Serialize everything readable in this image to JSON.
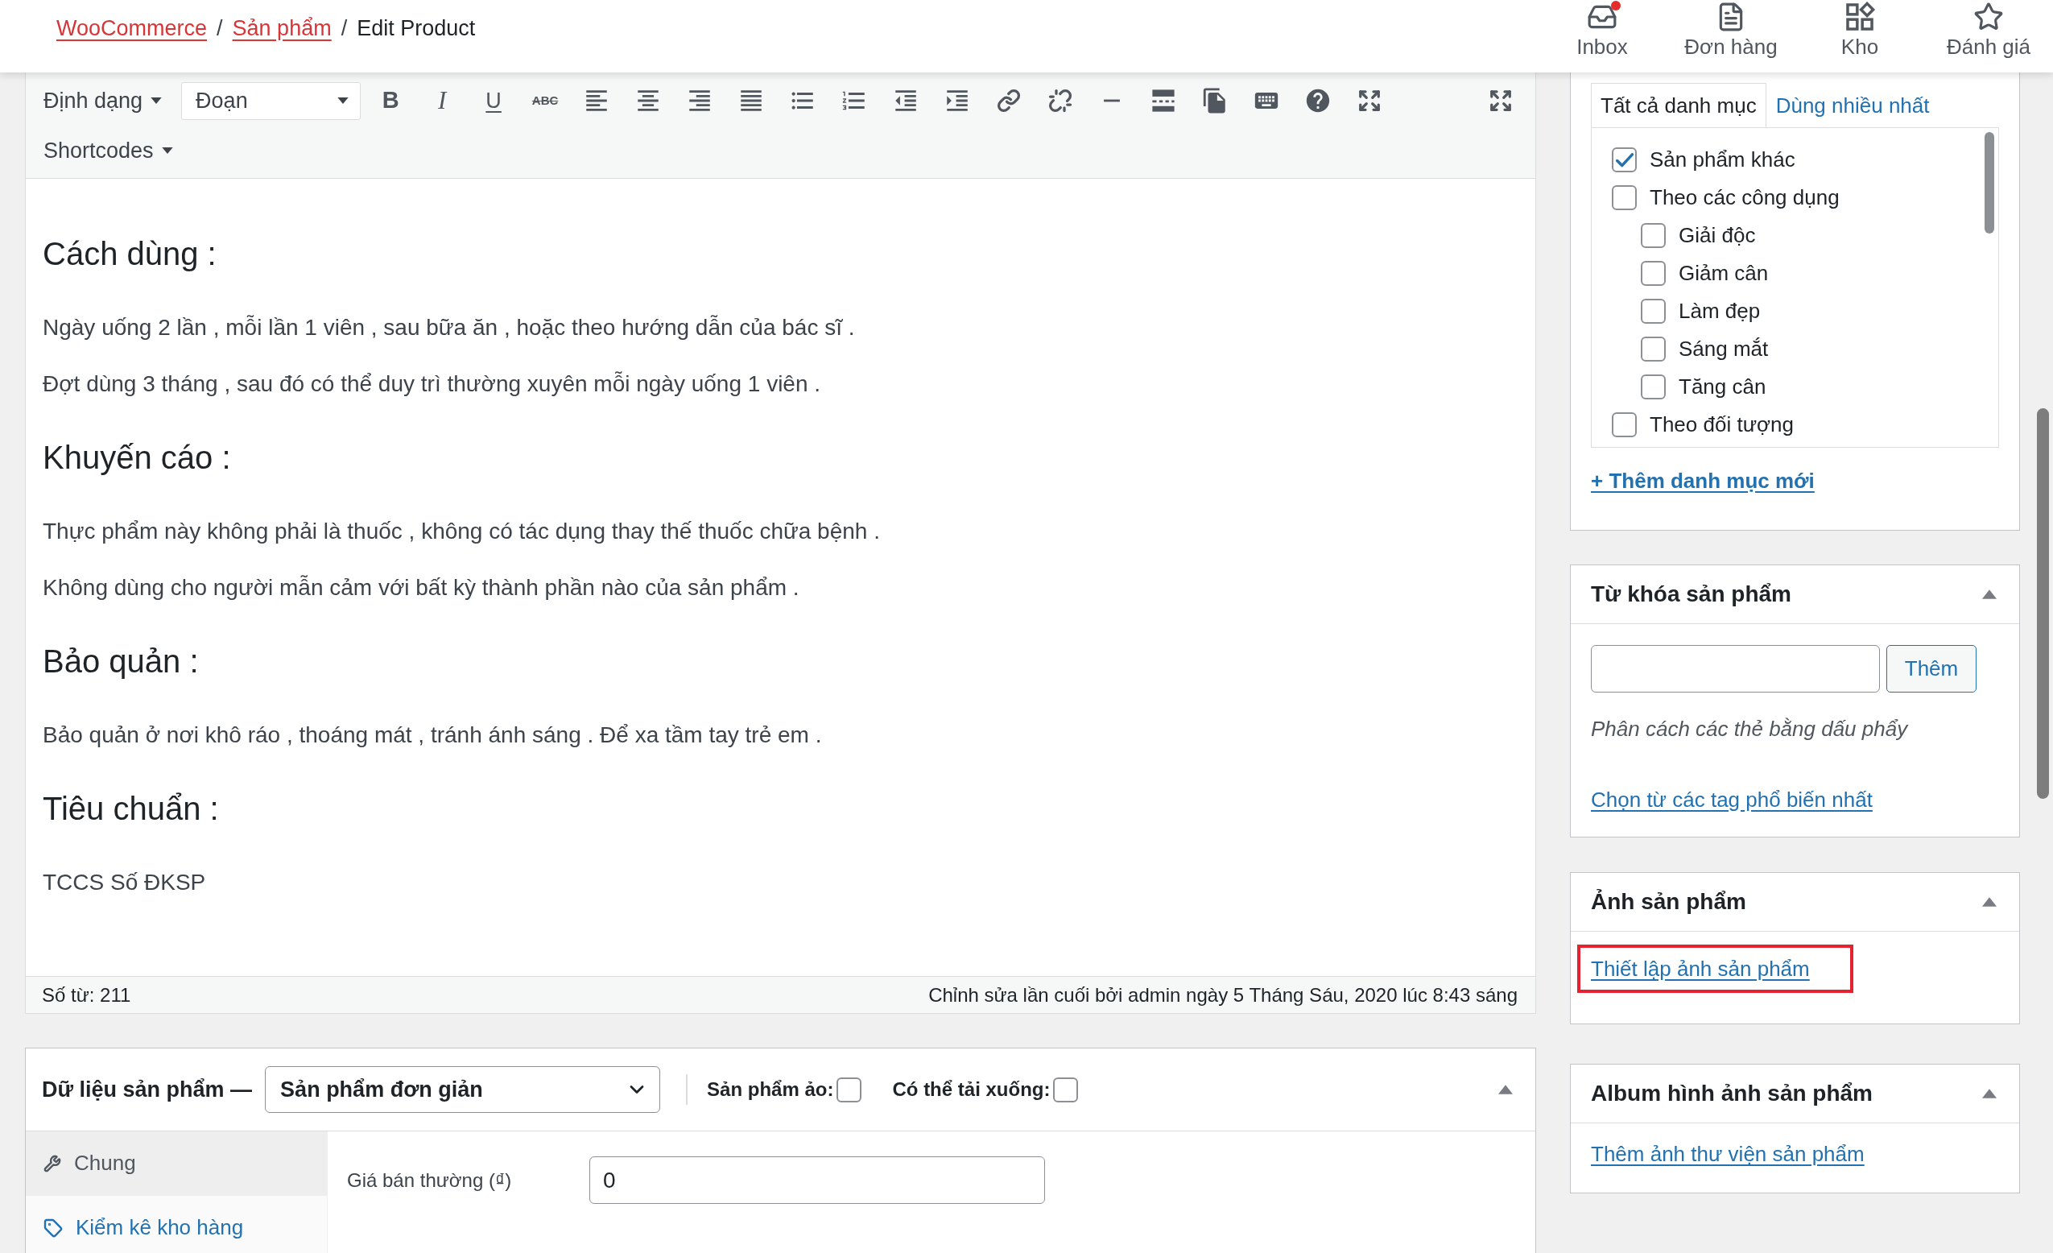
{
  "header": {
    "breadcrumb": [
      {
        "kind": "link",
        "label": "WooCommerce"
      },
      {
        "kind": "separator",
        "label": "/"
      },
      {
        "kind": "link",
        "label": "Sản phẩm"
      },
      {
        "kind": "separator",
        "label": "/"
      },
      {
        "kind": "current",
        "label": "Edit Product"
      }
    ],
    "nav": [
      {
        "label": "Inbox",
        "unread": true
      },
      {
        "label": "Đơn hàng",
        "unread": false
      },
      {
        "label": "Kho",
        "unread": false
      },
      {
        "label": "Đánh giá",
        "unread": false
      }
    ]
  },
  "editor": {
    "toolbar": {
      "format_menu": "Định dạng",
      "block_format": "Đoạn",
      "text_buttons": [
        {
          "kind": "bold",
          "label": "B"
        },
        {
          "kind": "italic",
          "label": "I"
        },
        {
          "kind": "underline",
          "label": "U"
        },
        {
          "kind": "strike",
          "label": "ABC"
        }
      ],
      "shortcodes_menu": "Shortcodes"
    },
    "content": [
      {
        "kind": "heading",
        "text": "Cách dùng :"
      },
      {
        "kind": "paragraph",
        "text": "Ngày uống 2 lần , mỗi lần 1 viên , sau bữa ăn , hoặc theo hướng dẫn của bác sĩ ."
      },
      {
        "kind": "paragraph",
        "text": "Đợt dùng 3 tháng , sau đó có thể duy trì thường xuyên mỗi ngày uống 1 viên ."
      },
      {
        "kind": "heading",
        "text": "Khuyến cáo :"
      },
      {
        "kind": "paragraph",
        "text": "Thực phẩm này không phải là thuốc , không có tác dụng thay thế thuốc chữa bệnh ."
      },
      {
        "kind": "paragraph",
        "text": "Không dùng cho người mẫn cảm với bất kỳ thành phần nào của sản phẩm ."
      },
      {
        "kind": "heading",
        "text": "Bảo quản :"
      },
      {
        "kind": "paragraph",
        "text": "Bảo quản ở nơi khô ráo , thoáng mát , tránh ánh sáng . Để xa tầm tay trẻ em ."
      },
      {
        "kind": "heading",
        "text": "Tiêu chuẩn :"
      },
      {
        "kind": "paragraph",
        "text": "TCCS Số ĐKSP"
      }
    ],
    "word_count": "Số từ: 211",
    "last_edited": "Chỉnh sửa lần cuối bởi admin ngày 5 Tháng Sáu, 2020 lúc 8:43 sáng"
  },
  "product_data": {
    "title": "Dữ liệu sản phẩm —",
    "product_type": "Sản phẩm đơn giản",
    "options": [
      {
        "label": "Sản phẩm ảo:",
        "checked": false
      },
      {
        "label": "Có thể tải xuống:",
        "checked": false
      }
    ],
    "expanded": true,
    "tabs": [
      {
        "label": "Chung",
        "selected": true
      },
      {
        "label": "Kiểm kê kho hàng",
        "selected": false
      }
    ],
    "fields": [
      {
        "label": "Giá bán thường (₫)",
        "value": "0"
      }
    ]
  },
  "sidebar": {
    "categories": {
      "tabs": [
        {
          "label": "Tất cả danh mục",
          "selected": true
        },
        {
          "label": "Dùng nhiều nhất",
          "selected": false
        }
      ],
      "items": [
        {
          "label": "Sản phẩm khác",
          "checked": true
        },
        {
          "label": "Theo các công dụng",
          "checked": false,
          "children": [
            {
              "label": "Giải độc",
              "checked": false
            },
            {
              "label": "Giảm cân",
              "checked": false
            },
            {
              "label": "Làm đẹp",
              "checked": false
            },
            {
              "label": "Sáng mắt",
              "checked": false
            },
            {
              "label": "Tăng cân",
              "checked": false
            }
          ]
        },
        {
          "label": "Theo đối tượng",
          "checked": false
        }
      ],
      "add_link": "+ Thêm danh mục mới"
    },
    "tags": {
      "title": "Từ khóa sản phẩm",
      "expanded": true,
      "add_button": "Thêm",
      "hint": "Phân cách các thẻ bằng dấu phẩy",
      "popular_link": "Chọn từ các tag phổ biến nhất"
    },
    "product_image": {
      "title": "Ảnh sản phẩm",
      "expanded": true,
      "set_link": "Thiết lập ảnh sản phẩm",
      "highlighted": true
    },
    "gallery": {
      "title": "Album hình ảnh sản phẩm",
      "expanded": true,
      "add_link": "Thêm ảnh thư viện sản phẩm"
    }
  }
}
